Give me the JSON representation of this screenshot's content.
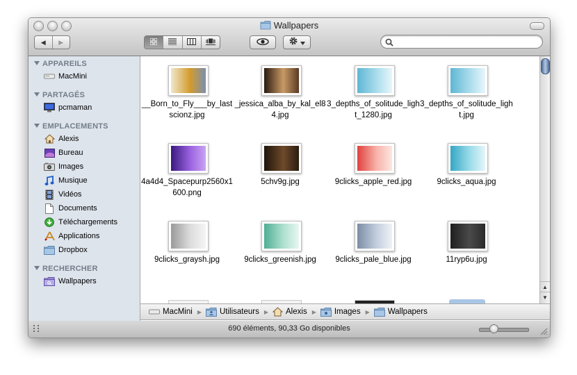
{
  "window": {
    "title": "Wallpapers"
  },
  "toolbar": {
    "back_label": "◀",
    "forward_label": "▶",
    "view_modes": [
      "icons",
      "list",
      "columns",
      "coverflow"
    ],
    "active_view": "icons",
    "quicklook_icon": "eye-icon",
    "action_icon": "gear-icon",
    "search_placeholder": "",
    "search_value": ""
  },
  "sidebar": {
    "sections": [
      {
        "header": "APPAREILS",
        "items": [
          {
            "label": "MacMini",
            "icon": "drive-icon"
          }
        ]
      },
      {
        "header": "PARTAGÉS",
        "items": [
          {
            "label": "pcmaman",
            "icon": "monitor-icon"
          }
        ]
      },
      {
        "header": "EMPLACEMENTS",
        "items": [
          {
            "label": "Alexis",
            "icon": "home-icon"
          },
          {
            "label": "Bureau",
            "icon": "desktop-icon"
          },
          {
            "label": "Images",
            "icon": "camera-icon"
          },
          {
            "label": "Musique",
            "icon": "music-icon"
          },
          {
            "label": "Vidéos",
            "icon": "film-icon"
          },
          {
            "label": "Documents",
            "icon": "document-icon"
          },
          {
            "label": "Téléchargements",
            "icon": "download-icon"
          },
          {
            "label": "Applications",
            "icon": "applications-icon"
          },
          {
            "label": "Dropbox",
            "icon": "folder-icon"
          }
        ]
      },
      {
        "header": "RECHERCHER",
        "items": [
          {
            "label": "Wallpapers",
            "icon": "smart-folder-icon"
          }
        ]
      }
    ]
  },
  "files": [
    {
      "name": "__Born_to_Fly___by_lastscionz.jpg",
      "colors": [
        "#efe7cc",
        "#d39b2c",
        "#7a8fb0"
      ]
    },
    {
      "name": "_jessica_alba_by_kal_el84.jpg",
      "colors": [
        "#2a1b10",
        "#c99a66",
        "#5a3a22"
      ]
    },
    {
      "name": "3_depths_of_solitude_light_1280.jpg",
      "colors": [
        "#5fb6d4",
        "#a9dcec",
        "#e8f6fb"
      ]
    },
    {
      "name": "3_depths_of_solitude_light.jpg",
      "colors": [
        "#5fb6d4",
        "#a9dcec",
        "#e8f6fb"
      ]
    },
    {
      "name": "4a4d4_Spacepurp2560x1600.png",
      "colors": [
        "#3a1980",
        "#9b62e0",
        "#c9a4f2"
      ]
    },
    {
      "name": "5chv9g.jpg",
      "colors": [
        "#1f140b",
        "#6e4a2a",
        "#2b1d10"
      ]
    },
    {
      "name": "9clicks_apple_red.jpg",
      "colors": [
        "#e0413e",
        "#f7b3a9",
        "#fde6e1"
      ]
    },
    {
      "name": "9clicks_aqua.jpg",
      "colors": [
        "#35a7c4",
        "#9adbe9",
        "#e4f6fa"
      ]
    },
    {
      "name": "9clicks_graysh.jpg",
      "colors": [
        "#9a9a9a",
        "#dcdcdc",
        "#f5f5f5"
      ]
    },
    {
      "name": "9clicks_greenish.jpg",
      "colors": [
        "#4fae94",
        "#aee0cf",
        "#e8f7f1"
      ]
    },
    {
      "name": "9clicks_pale_blue.jpg",
      "colors": [
        "#7b8da6",
        "#c2cedd",
        "#eef2f7"
      ]
    },
    {
      "name": "11ryp6u.jpg",
      "colors": [
        "#1f1f1f",
        "#4a4a4a",
        "#2a2a2a"
      ]
    }
  ],
  "pathbar": {
    "crumbs": [
      {
        "label": "MacMini",
        "icon": "drive-icon"
      },
      {
        "label": "Utilisateurs",
        "icon": "users-folder-icon"
      },
      {
        "label": "Alexis",
        "icon": "home-icon"
      },
      {
        "label": "Images",
        "icon": "camera-icon"
      },
      {
        "label": "Wallpapers",
        "icon": "folder-icon"
      }
    ]
  },
  "status": {
    "text": "690 éléments, 90,33 Go disponibles"
  }
}
